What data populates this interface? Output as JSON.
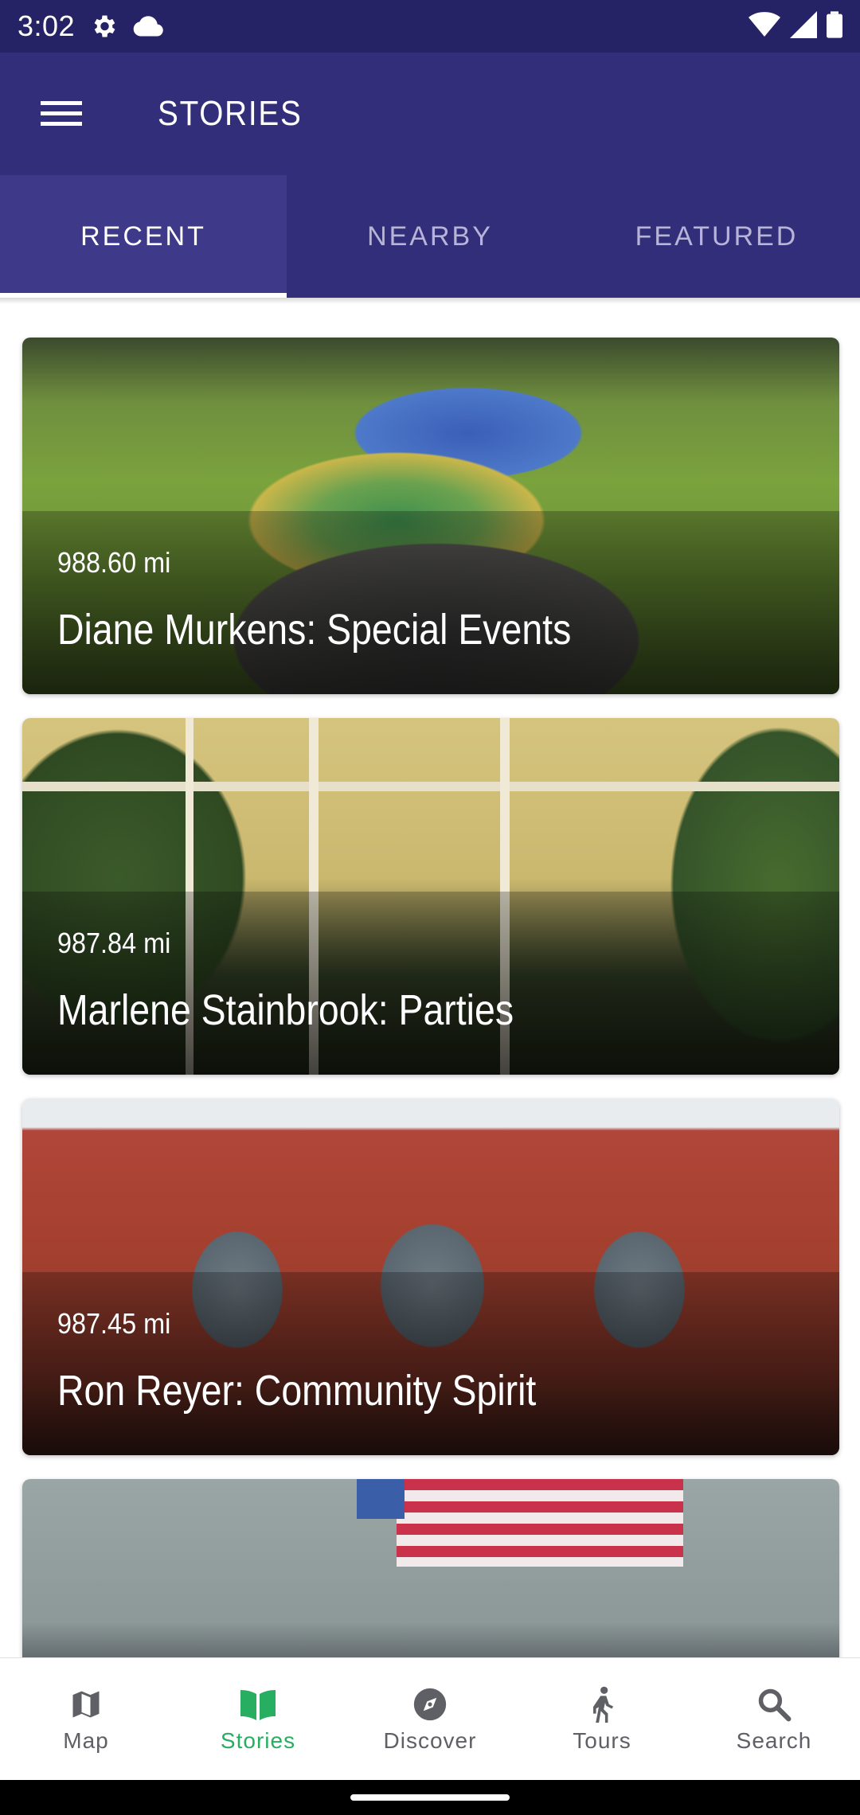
{
  "status_bar": {
    "time": "3:02",
    "icons": [
      "gear-icon",
      "cloud-icon",
      "wifi-icon",
      "signal-icon",
      "battery-icon"
    ]
  },
  "app_bar": {
    "title": "STORIES"
  },
  "tabs": [
    {
      "label": "RECENT",
      "active": true
    },
    {
      "label": "NEARBY",
      "active": false
    },
    {
      "label": "FEATURED",
      "active": false
    }
  ],
  "stories": [
    {
      "distance": "988.60 mi",
      "title": "Diane Murkens: Special Events"
    },
    {
      "distance": "987.84 mi",
      "title": "Marlene Stainbrook: Parties"
    },
    {
      "distance": "987.45 mi",
      "title": "Ron Reyer: Community Spirit"
    }
  ],
  "bottom_nav": [
    {
      "label": "Map",
      "icon": "map-icon",
      "active": false
    },
    {
      "label": "Stories",
      "icon": "book-icon",
      "active": true
    },
    {
      "label": "Discover",
      "icon": "compass-icon",
      "active": false
    },
    {
      "label": "Tours",
      "icon": "walking-icon",
      "active": false
    },
    {
      "label": "Search",
      "icon": "search-icon",
      "active": false
    }
  ],
  "colors": {
    "primary": "#332e7a",
    "status_bar": "#262266",
    "accent_active": "#27ae60"
  }
}
